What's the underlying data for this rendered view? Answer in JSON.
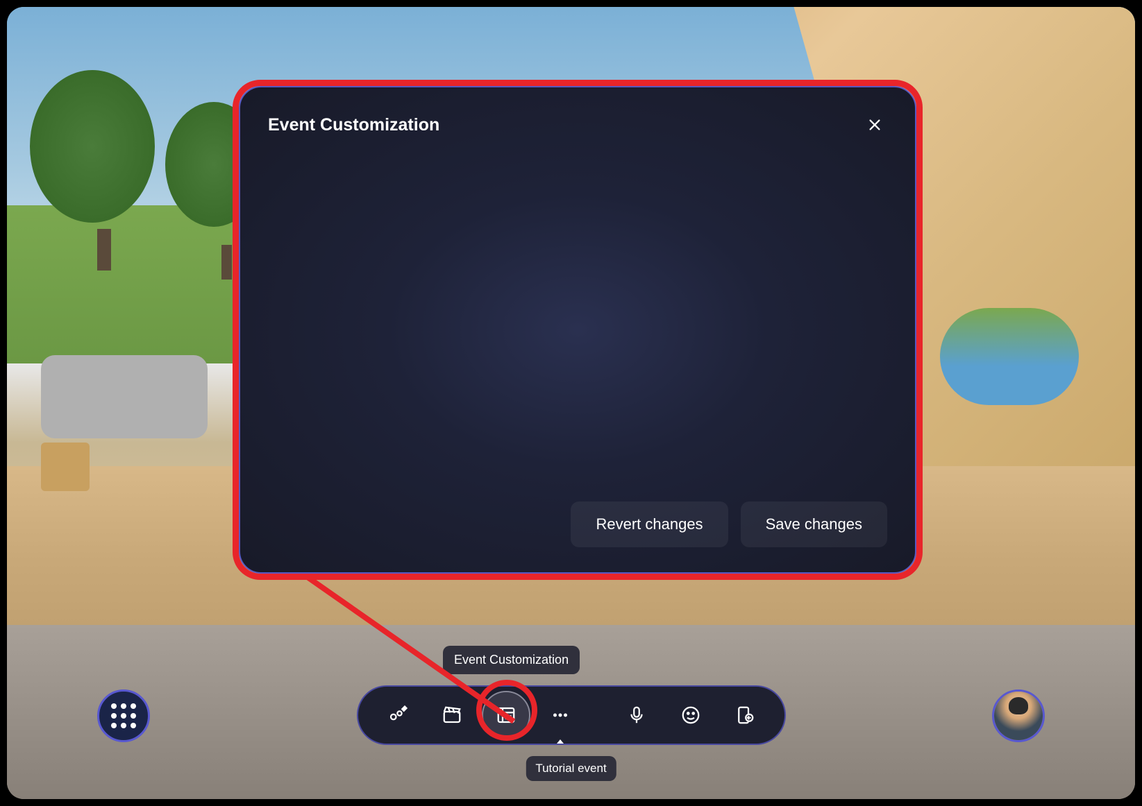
{
  "modal": {
    "title": "Event Customization",
    "revert_label": "Revert changes",
    "save_label": "Save changes"
  },
  "tooltip": {
    "event_customization": "Event Customization",
    "tutorial_event": "Tutorial event"
  },
  "toolbar": {
    "items": [
      {
        "name": "environment-editor",
        "icon": "paint"
      },
      {
        "name": "media",
        "icon": "clapperboard"
      },
      {
        "name": "event-customization",
        "icon": "newspaper",
        "active": true
      },
      {
        "name": "more-options",
        "icon": "ellipsis",
        "caret": true
      },
      {
        "name": "microphone",
        "icon": "mic"
      },
      {
        "name": "reactions",
        "icon": "smile"
      },
      {
        "name": "leave",
        "icon": "door"
      }
    ]
  },
  "colors": {
    "highlight": "#e8252a",
    "accent": "#5858d0",
    "panel_bg": "#1e2030"
  }
}
